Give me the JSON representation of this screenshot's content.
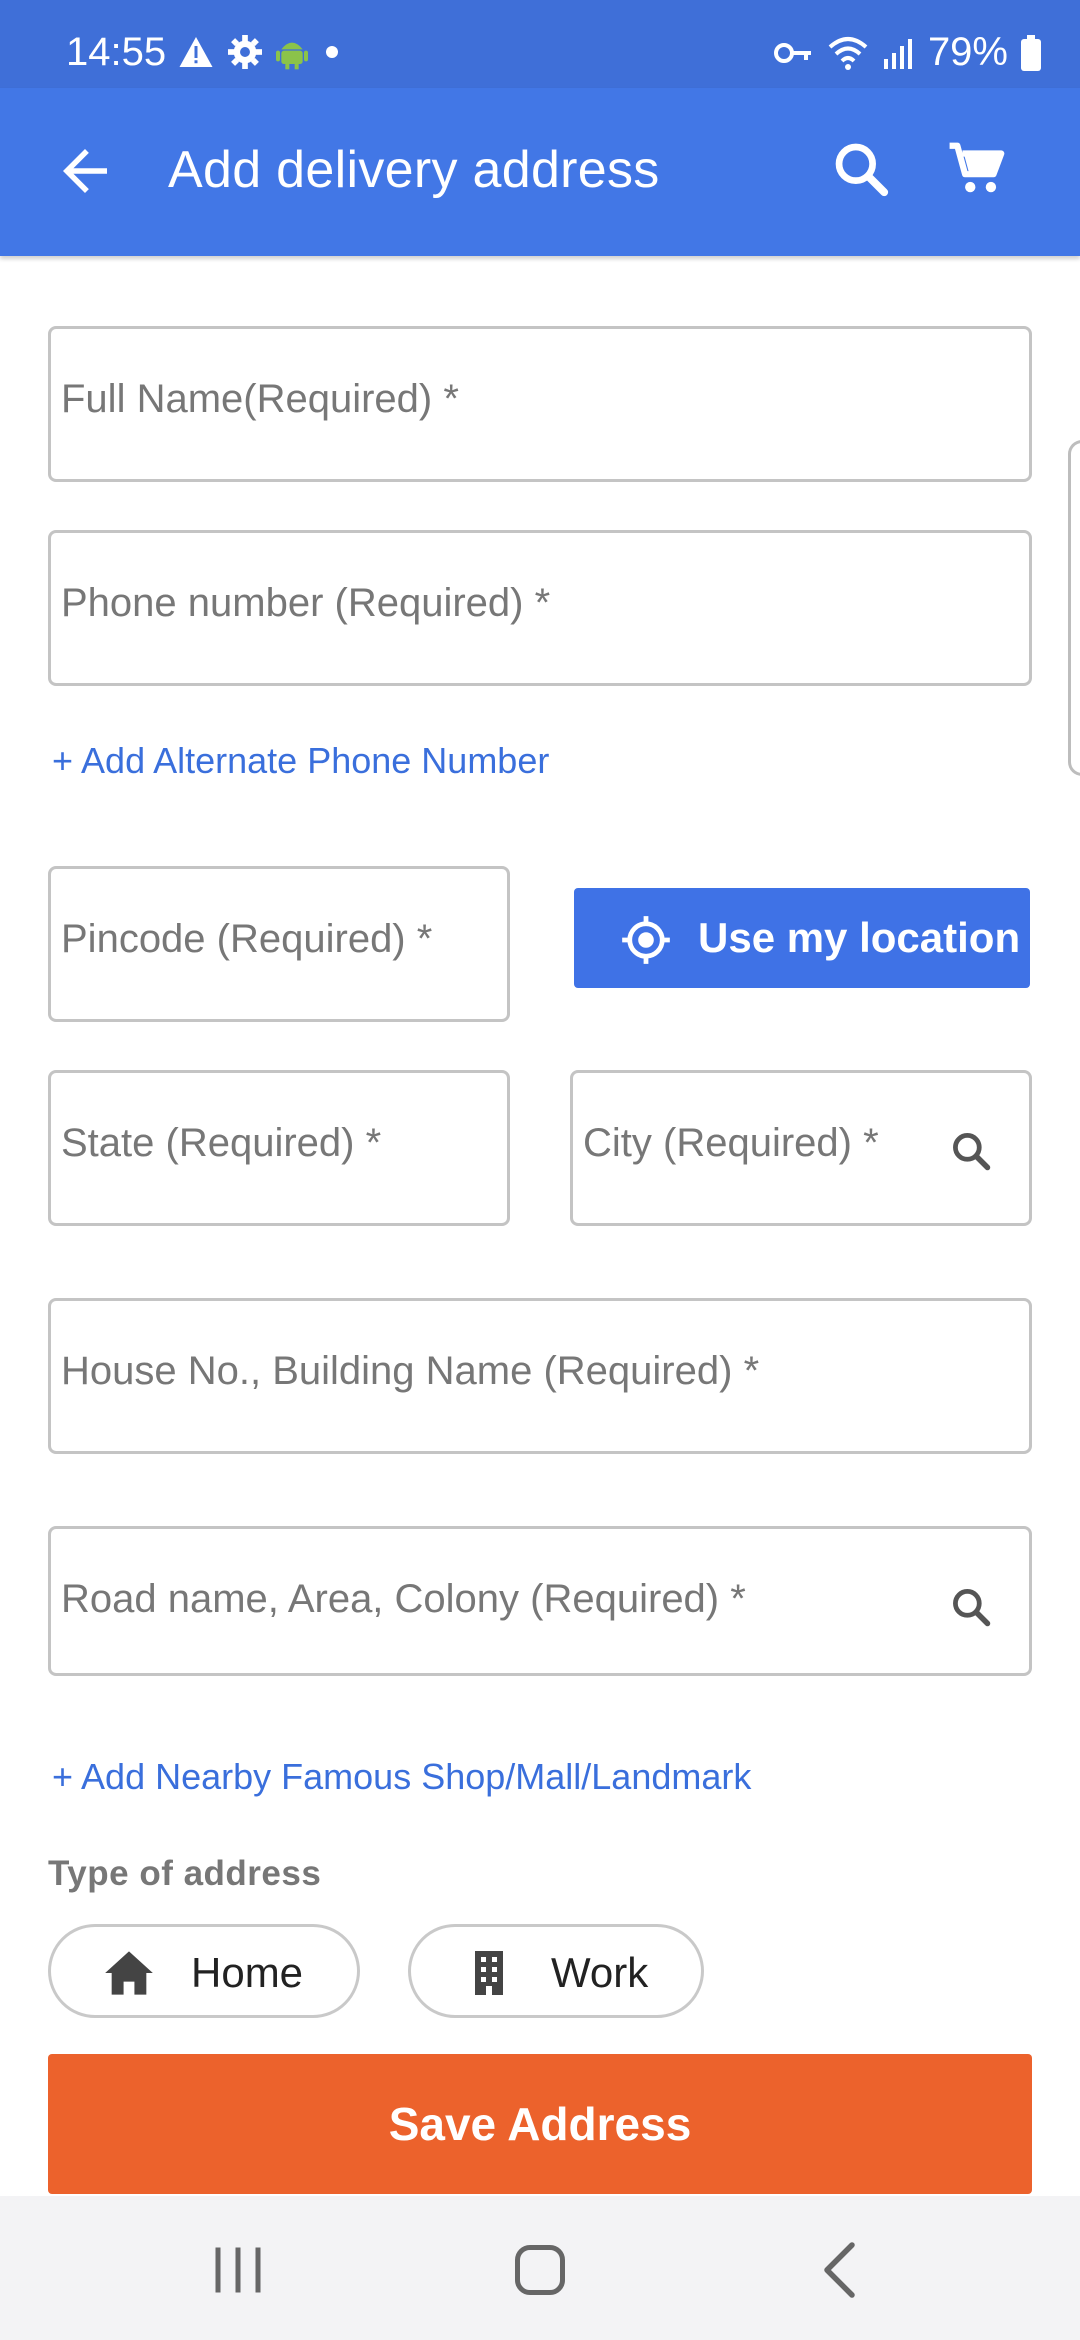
{
  "status_bar": {
    "time": "14:55",
    "battery": "79%",
    "icons": [
      "warning-icon",
      "gear-icon",
      "android-icon",
      "dot-icon",
      "vpn-key-icon",
      "wifi-icon",
      "signal-icon",
      "battery-icon"
    ]
  },
  "app_bar": {
    "title": "Add delivery address",
    "icons": [
      "back-arrow-icon",
      "search-icon",
      "cart-icon"
    ]
  },
  "form": {
    "full_name": {
      "placeholder": "Full Name(Required)",
      "required_mark": "*"
    },
    "phone": {
      "placeholder": "Phone number (Required)",
      "required_mark": "*"
    },
    "alt_phone_link": "+ Add Alternate Phone Number",
    "pincode": {
      "placeholder": "Pincode (Required)",
      "required_mark": "*"
    },
    "use_location_label": "Use my location",
    "state": {
      "placeholder": "State (Required)",
      "required_mark": "*"
    },
    "city": {
      "placeholder": "City (Required)",
      "required_mark": "*"
    },
    "house": {
      "placeholder": "House No., Building Name (Required)",
      "required_mark": "*"
    },
    "road": {
      "placeholder": "Road name, Area, Colony (Required)",
      "required_mark": "*"
    },
    "landmark_link": "+ Add Nearby Famous Shop/Mall/Landmark",
    "address_type_label": "Type of address",
    "address_types": [
      {
        "label": "Home",
        "icon": "home-icon"
      },
      {
        "label": "Work",
        "icon": "building-icon"
      }
    ],
    "save_label": "Save Address"
  },
  "colors": {
    "app_bar": "#4277e6",
    "status_bar": "#3f6fd8",
    "link": "#3a6fdc",
    "primary_button": "#3f72e6",
    "save_button": "#ec622c"
  }
}
